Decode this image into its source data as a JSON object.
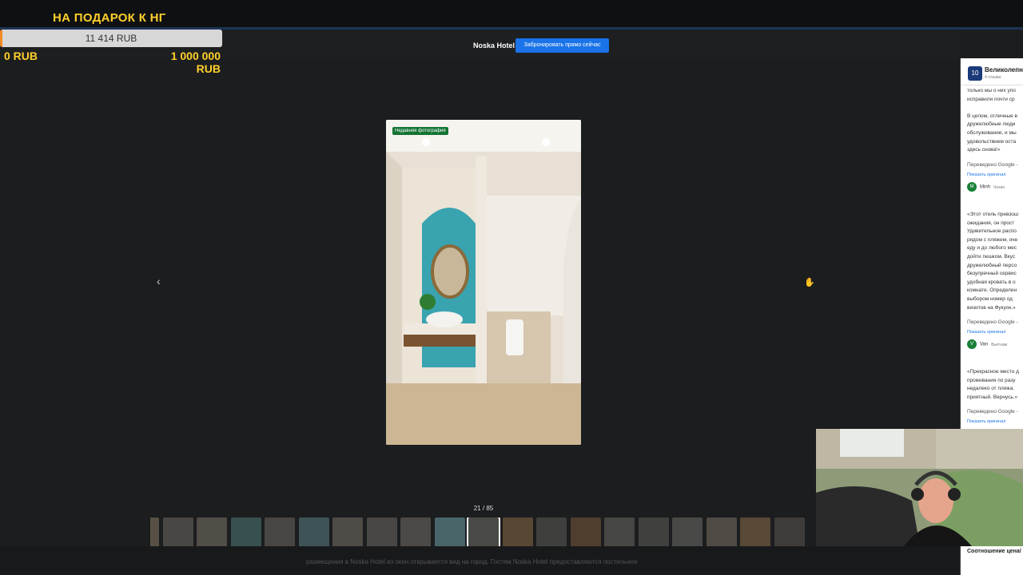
{
  "donation": {
    "title": "НА ПОДАРОК К НГ",
    "current": "11 414 RUB",
    "progress": 0.0114,
    "min": "0 RUB",
    "max_line1": "1 000 000",
    "max_line2": "RUB"
  },
  "header": {
    "hotel_name": "Noska Hotel",
    "book_button": "Забронировать прямо сейчас"
  },
  "viewer": {
    "badge": "Недавняя фотография",
    "counter": "21 / 85",
    "thumbnail_count": 20,
    "active_thumb": 10,
    "caption": "размещения в Noska Hotel из окон открывается вид на город. Гостям Noska Hotel предоставляются постельное"
  },
  "review_panel": {
    "score": "10",
    "title": "Великолепно",
    "subtitle": "4 отзыва",
    "reviews": [
      {
        "text": "только мы о них упо\nисправили почти ср\n\nВ целом, отличные в\nдружелюбные люди\nобслуживание, и мы\nудовольствием оста\nздесь снова!»",
        "translated": "Переведено Google -",
        "show_original": "Показать оригинал",
        "avatar": "M",
        "user": "Minh",
        "country": "Чехия"
      },
      {
        "text": "«Этот отель превзош\nожидания, он прост\nУдивительное распо\nрядом с пляжем, оче\nеду и до любого мес\nдойти пешком. Вкус\nдружелюбный персо\nбезупречный сервис\nудобная кровать в о\nкомнате. Определен\nвыбором номер од\nвизитов на Фукуок.»",
        "translated": "Переведено Google -",
        "show_original": "Показать оригинал",
        "avatar": "V",
        "user": "Van",
        "country": "Вьетнам"
      },
      {
        "text": "«Прекрасное место д\nпроживания по разу\nнедалеко от пляжа.\nприятный. Вернусь.»",
        "translated": "Переведено Google -",
        "show_original": "Показать оригинал"
      }
    ],
    "bottom_label": "Соотношение цена/"
  }
}
